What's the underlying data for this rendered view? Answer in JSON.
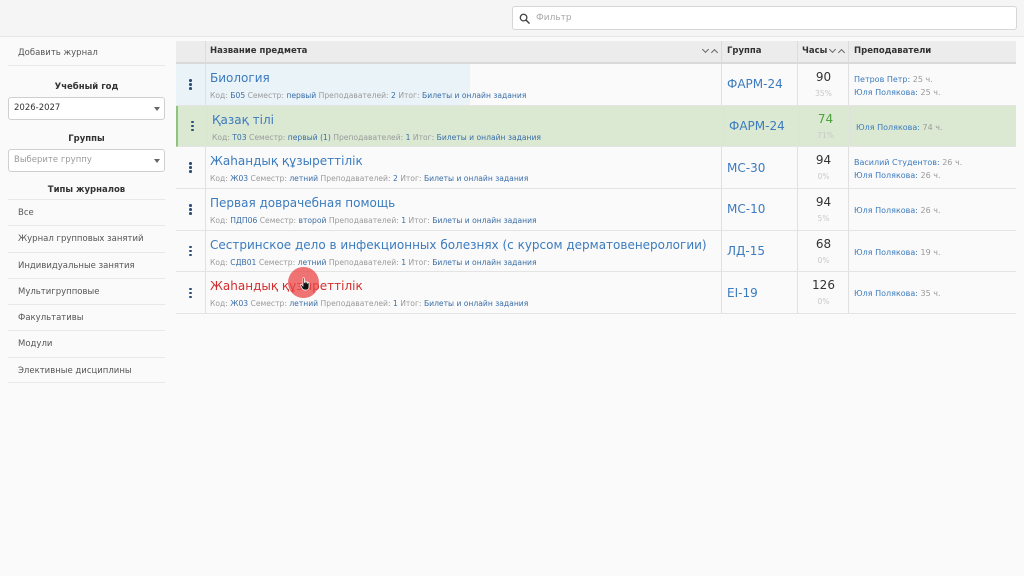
{
  "search": {
    "placeholder": "Фильтр"
  },
  "sidebar": {
    "add_journal": "Добавить журнал",
    "year_label": "Учебный год",
    "year_value": "2026-2027",
    "groups_label": "Группы",
    "groups_placeholder": "Выберите группу",
    "types_label": "Типы журналов",
    "types": [
      "Все",
      "Журнал групповых занятий",
      "Индивидуальные занятия",
      "Мультигрупповые",
      "Факультативы",
      "Модули",
      "Элективные дисциплины"
    ]
  },
  "table": {
    "headers": {
      "name": "Название предмета",
      "group": "Группа",
      "hours": "Часы",
      "teachers": "Преподаватели"
    },
    "meta_labels": {
      "code": "Код:",
      "semester": "Семестр:",
      "teachers": "Преподавателей:",
      "result": "Итог:"
    },
    "rows": [
      {
        "name": "Биология",
        "code": "Б05",
        "semester": "первый",
        "teacher_count": "2",
        "result": "Билеты и онлайн задания",
        "group": "ФАРМ-24",
        "hours": "90",
        "percent": "35%",
        "teachers": [
          {
            "name": "Петров Петр:",
            "hours": "25 ч."
          },
          {
            "name": "Юля Полякова:",
            "hours": "25 ч."
          }
        ]
      },
      {
        "name": "Қазақ тілі",
        "code": "Т03",
        "semester": "первый (1)",
        "teacher_count": "1",
        "result": "Билеты и онлайн задания",
        "group": "ФАРМ-24",
        "hours": "74",
        "percent": "71%",
        "teachers": [
          {
            "name": "Юля Полякова:",
            "hours": "74 ч."
          }
        ]
      },
      {
        "name": "Жаһандық құзыреттілік",
        "code": "Ж03",
        "semester": "летний",
        "teacher_count": "2",
        "result": "Билеты и онлайн задания",
        "group": "МС-30",
        "hours": "94",
        "percent": "0%",
        "teachers": [
          {
            "name": "Василий Студентов:",
            "hours": "26 ч."
          },
          {
            "name": "Юля Полякова:",
            "hours": "26 ч."
          }
        ]
      },
      {
        "name": "Первая доврачебная помощь",
        "code": "ПДП06",
        "semester": "второй",
        "teacher_count": "1",
        "result": "Билеты и онлайн задания",
        "group": "МС-10",
        "hours": "94",
        "percent": "5%",
        "teachers": [
          {
            "name": "Юля Полякова:",
            "hours": "26 ч."
          }
        ]
      },
      {
        "name": "Сестринское дело в инфекционных болезнях (с курсом дерматовенерологии)",
        "code": "СДВ01",
        "semester": "летний",
        "teacher_count": "1",
        "result": "Билеты и онлайн задания",
        "group": "ЛД-15",
        "hours": "68",
        "percent": "0%",
        "teachers": [
          {
            "name": "Юля Полякова:",
            "hours": "19 ч."
          }
        ]
      },
      {
        "name": "Жаһандық құзыреттілік",
        "code": "Ж03",
        "semester": "летний",
        "teacher_count": "1",
        "result": "Билеты и онлайн задания",
        "group": "ЕІ-19",
        "hours": "126",
        "percent": "0%",
        "teachers": [
          {
            "name": "Юля Полякова:",
            "hours": "35 ч."
          }
        ]
      }
    ]
  },
  "colors": {
    "link": "#3b7bbf",
    "highlight_row": "#dbe9d3",
    "hover_link": "#d42d2d",
    "hours_green": "#4ca23b",
    "click_indicator": "#eb4646"
  }
}
